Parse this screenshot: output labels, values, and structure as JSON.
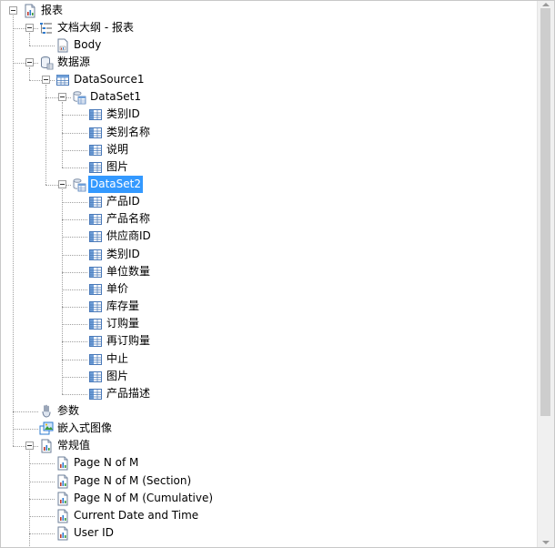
{
  "tree": [
    {
      "id": "report",
      "label": "报表",
      "level": 0,
      "icon": "report-icon",
      "expanded": true,
      "has_children": true
    },
    {
      "id": "outline",
      "label": "文档大纲 - 报表",
      "level": 1,
      "icon": "outline-icon",
      "expanded": true,
      "has_children": true
    },
    {
      "id": "body",
      "label": "Body",
      "level": 2,
      "icon": "body-icon"
    },
    {
      "id": "datasource-root",
      "label": "数据源",
      "level": 1,
      "icon": "datasource-icon",
      "expanded": true,
      "has_children": true
    },
    {
      "id": "datasource1",
      "label": "DataSource1",
      "level": 2,
      "icon": "table-icon",
      "expanded": true,
      "has_children": true
    },
    {
      "id": "dataset1",
      "label": "DataSet1",
      "level": 3,
      "icon": "dataset-icon",
      "expanded": true,
      "has_children": true
    },
    {
      "id": "ds1-category-id",
      "label": "类别ID",
      "level": 4,
      "icon": "field-icon"
    },
    {
      "id": "ds1-category-name",
      "label": "类别名称",
      "level": 4,
      "icon": "field-icon"
    },
    {
      "id": "ds1-description",
      "label": "说明",
      "level": 4,
      "icon": "field-icon"
    },
    {
      "id": "ds1-picture",
      "label": "图片",
      "level": 4,
      "icon": "field-icon"
    },
    {
      "id": "dataset2",
      "label": "DataSet2",
      "level": 3,
      "icon": "dataset-icon",
      "expanded": true,
      "has_children": true,
      "selected": true
    },
    {
      "id": "ds2-product-id",
      "label": "产品ID",
      "level": 4,
      "icon": "field-icon"
    },
    {
      "id": "ds2-product-name",
      "label": "产品名称",
      "level": 4,
      "icon": "field-icon"
    },
    {
      "id": "ds2-supplier-id",
      "label": "供应商ID",
      "level": 4,
      "icon": "field-icon"
    },
    {
      "id": "ds2-category-id",
      "label": "类别ID",
      "level": 4,
      "icon": "field-icon"
    },
    {
      "id": "ds2-unit-qty",
      "label": "单位数量",
      "level": 4,
      "icon": "field-icon"
    },
    {
      "id": "ds2-unit-price",
      "label": "单价",
      "level": 4,
      "icon": "field-icon"
    },
    {
      "id": "ds2-stock",
      "label": "库存量",
      "level": 4,
      "icon": "field-icon"
    },
    {
      "id": "ds2-on-order",
      "label": "订购量",
      "level": 4,
      "icon": "field-icon"
    },
    {
      "id": "ds2-reorder",
      "label": "再订购量",
      "level": 4,
      "icon": "field-icon"
    },
    {
      "id": "ds2-discontinued",
      "label": "中止",
      "level": 4,
      "icon": "field-icon"
    },
    {
      "id": "ds2-picture",
      "label": "图片",
      "level": 4,
      "icon": "field-icon"
    },
    {
      "id": "ds2-product-desc",
      "label": "产品描述",
      "level": 4,
      "icon": "field-icon"
    },
    {
      "id": "parameters",
      "label": "参数",
      "level": 1,
      "icon": "parameter-icon"
    },
    {
      "id": "embedded-images",
      "label": "嵌入式图像",
      "level": 1,
      "icon": "image-icon"
    },
    {
      "id": "common-values",
      "label": "常规值",
      "level": 1,
      "icon": "common-values-icon",
      "expanded": true,
      "has_children": true
    },
    {
      "id": "page-n-of-m",
      "label": "Page N of M",
      "level": 2,
      "icon": "value-icon"
    },
    {
      "id": "page-n-of-m-section",
      "label": "Page N of M (Section)",
      "level": 2,
      "icon": "value-icon"
    },
    {
      "id": "page-n-of-m-cumulative",
      "label": "Page N of M (Cumulative)",
      "level": 2,
      "icon": "value-icon"
    },
    {
      "id": "current-date-time",
      "label": "Current Date and Time",
      "level": 2,
      "icon": "value-icon"
    },
    {
      "id": "user-id",
      "label": "User ID",
      "level": 2,
      "icon": "value-icon"
    }
  ],
  "colors": {
    "selection": "#3399ff",
    "selection_text": "#ffffff",
    "tree_lines": "#a0a0a0",
    "scrollbar_track": "#f0f0f0",
    "scrollbar_thumb": "#cdcdcd"
  }
}
